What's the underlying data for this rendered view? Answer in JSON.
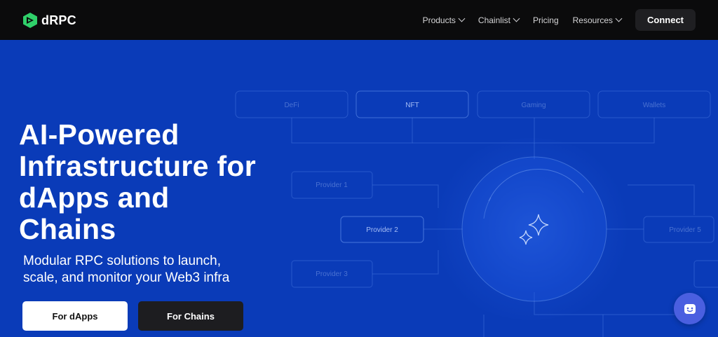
{
  "brand": {
    "name": "dRPC",
    "logo_color": "#2fd06a"
  },
  "nav": {
    "items": [
      {
        "label": "Products",
        "has_dropdown": true
      },
      {
        "label": "Chainlist",
        "has_dropdown": true
      },
      {
        "label": "Pricing",
        "has_dropdown": false
      },
      {
        "label": "Resources",
        "has_dropdown": true
      }
    ],
    "connect_label": "Connect"
  },
  "hero": {
    "headline": "AI-Powered Infrastructure for dApps and Chains",
    "subheadline": "Modular RPC solutions to launch, scale, and monitor your Web3 infra",
    "primary_cta": "For dApps",
    "secondary_cta": "For Chains",
    "background_color": "#0a3bb8"
  },
  "diagram": {
    "categories": [
      "DeFi",
      "NFT",
      "Gaming",
      "Wallets"
    ],
    "providers": [
      "Provider 1",
      "Provider 2",
      "Provider 3",
      "Provider 5"
    ],
    "center_icon": "sparkle-icon"
  },
  "chat_widget": {
    "icon": "chat-bot-icon"
  }
}
